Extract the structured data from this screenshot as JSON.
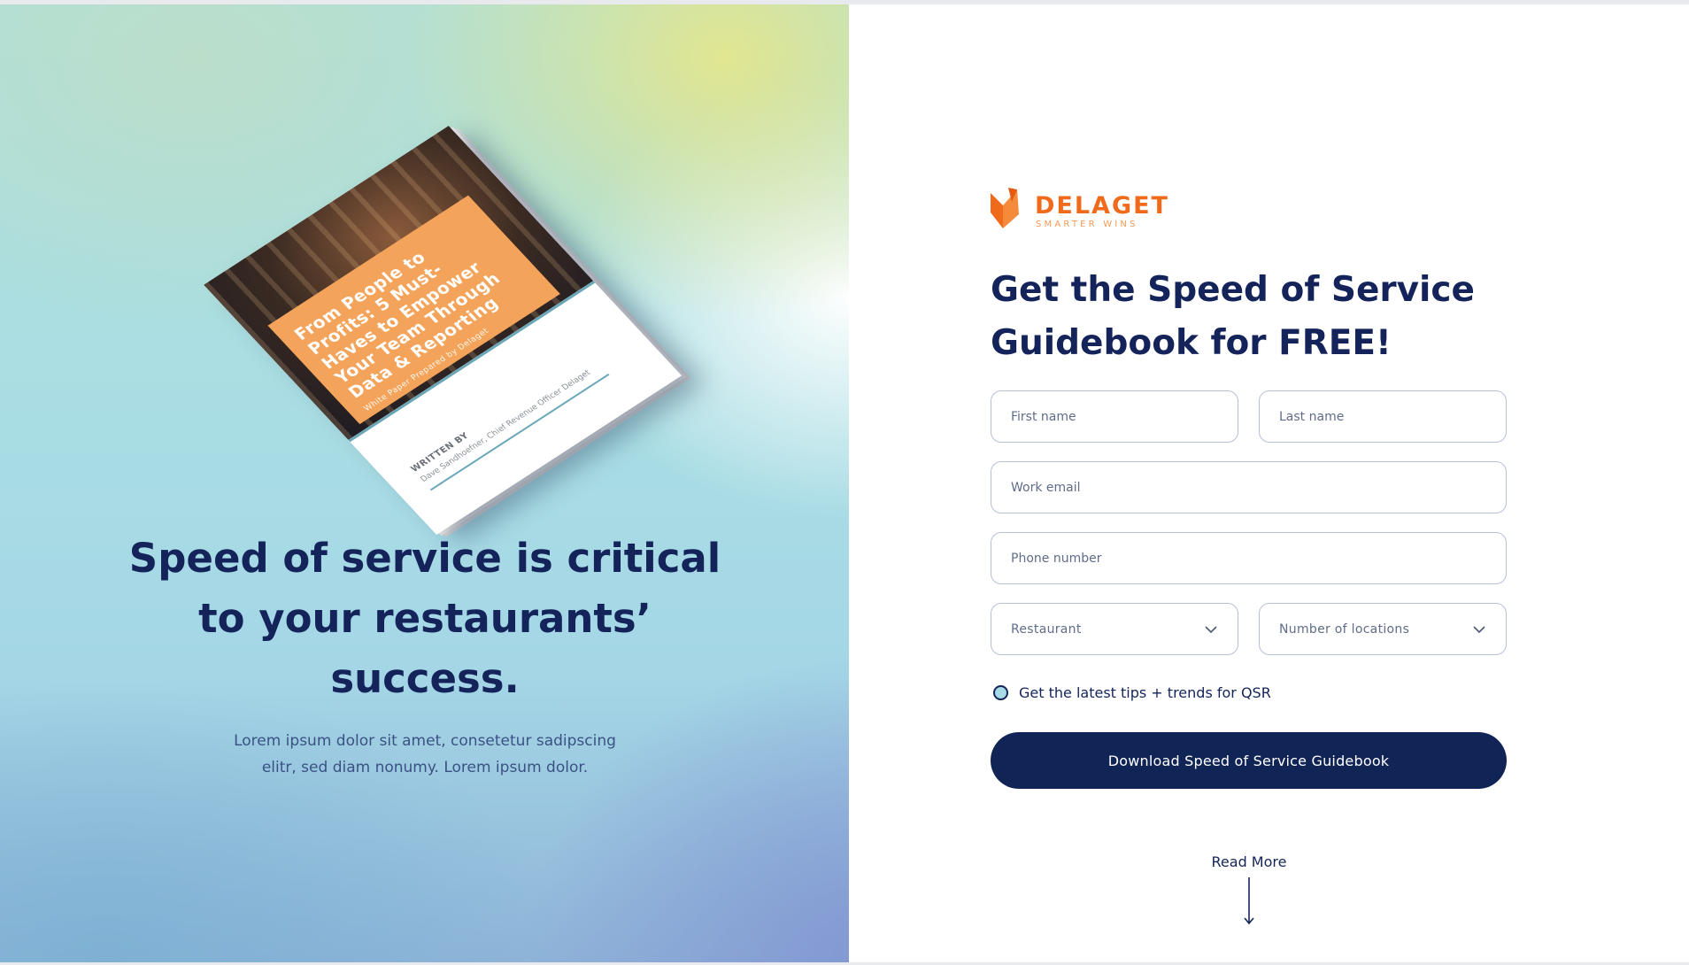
{
  "hero": {
    "brochure": {
      "title": "From People to Profits: 5 Must-Haves to Empower Your Team Through Data & Reporting",
      "subtitle": "White Paper Prepared by Delaget",
      "written_by_label": "WRITTEN BY",
      "author": "Dave Sandhoefner, Chief Revenue Officer Delaget"
    },
    "headline": "Speed of service is critical to your restaurants’ success.",
    "body": "Lorem ipsum dolor sit amet, consetetur sadipscing elitr, sed diam nonumy. Lorem ipsum dolor."
  },
  "brand": {
    "name": "DELAGET",
    "tagline": "SMARTER WINS",
    "accent_color": "#f06a1c",
    "logo_icon": "fox-icon"
  },
  "form": {
    "title": "Get the Speed of Service Guidebook for FREE!",
    "fields": {
      "first_name": {
        "placeholder": "First name",
        "value": ""
      },
      "last_name": {
        "placeholder": "Last name",
        "value": ""
      },
      "work_email": {
        "placeholder": "Work email",
        "value": ""
      },
      "phone": {
        "placeholder": "Phone number",
        "value": ""
      }
    },
    "selects": {
      "industry": {
        "selected": "Restaurant",
        "icon": "chevron-down-icon"
      },
      "locations": {
        "selected": "Number of locations",
        "icon": "chevron-down-icon"
      }
    },
    "opt_in_label": "Get the latest tips + trends for QSR",
    "submit_label": "Download Speed of Service Guidebook",
    "primary_color": "#112456"
  },
  "read_more": {
    "label": "Read More",
    "icon": "arrow-down-icon"
  }
}
